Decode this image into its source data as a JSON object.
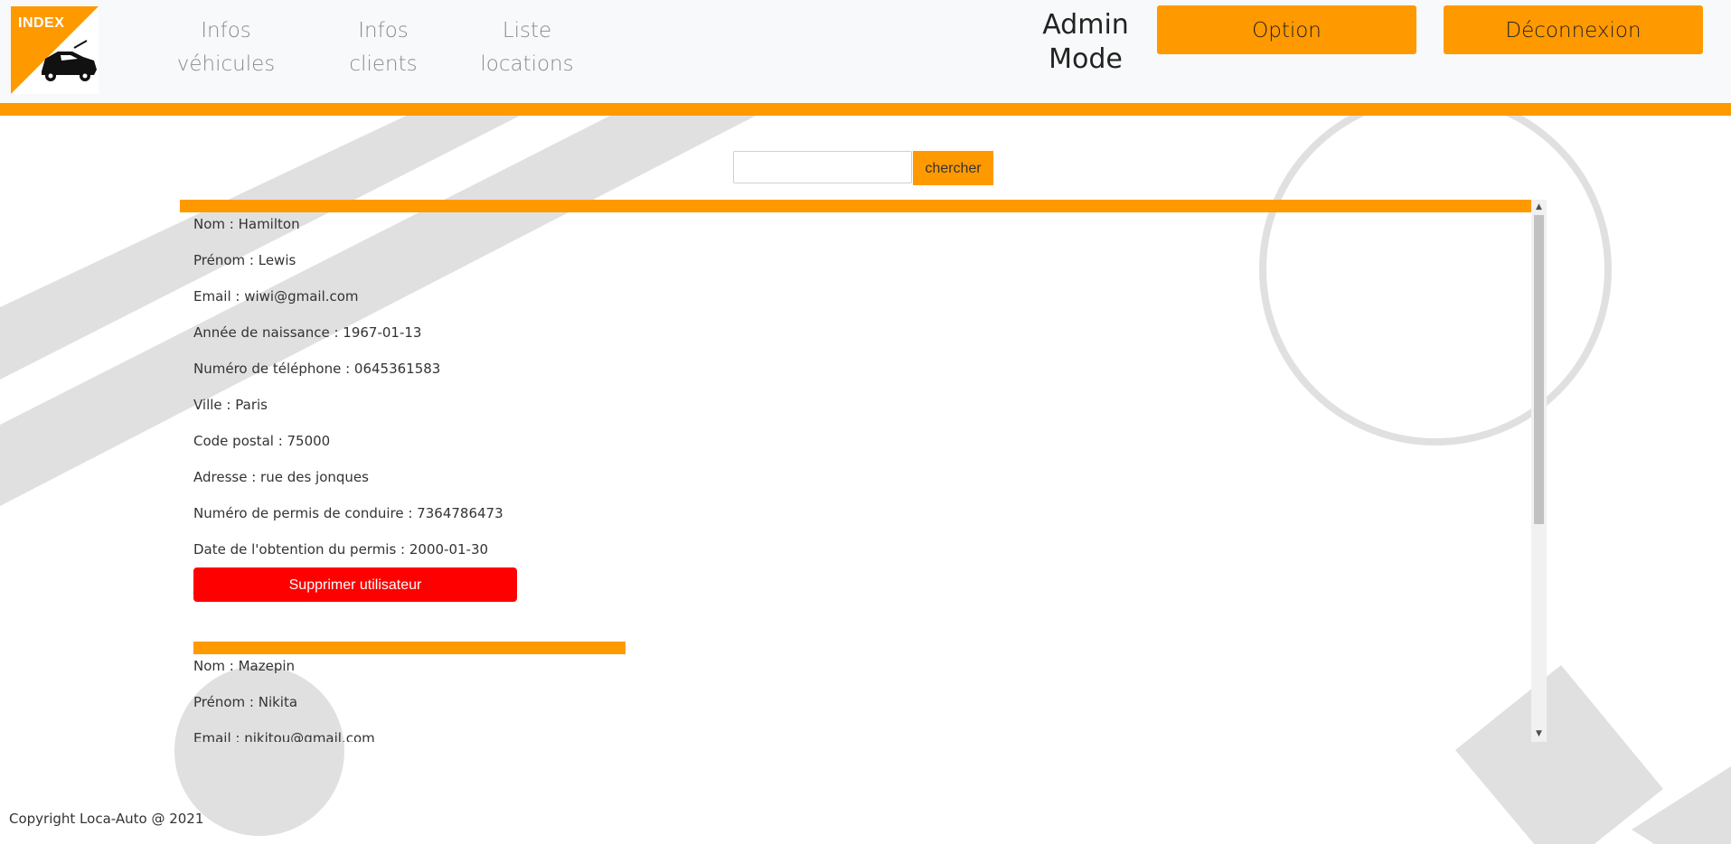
{
  "logo": {
    "label": "INDEX",
    "icon": "car-icon",
    "accent": "#ff9900"
  },
  "nav": [
    {
      "line1": "Infos",
      "line2": "véhicules"
    },
    {
      "line1": "Infos",
      "line2": "clients"
    },
    {
      "line1": "Liste",
      "line2": "locations"
    }
  ],
  "header": {
    "admin_line1": "Admin",
    "admin_line2": "Mode",
    "option_label": "Option",
    "logout_label": "Déconnexion"
  },
  "search": {
    "value": "",
    "button_label": "chercher"
  },
  "records": [
    {
      "fields": [
        "Nom : Hamilton",
        "Prénom : Lewis",
        "Email : wiwi@gmail.com",
        "Année de naissance : 1967-01-13",
        "Numéro de téléphone : 0645361583",
        "Ville : Paris",
        "Code postal : 75000",
        "Adresse : rue des jonques",
        "Numéro de permis de conduire : 7364786473",
        "Date de l'obtention du permis : 2000-01-30"
      ],
      "delete_label": "Supprimer utilisateur"
    },
    {
      "fields": [
        "Nom : Mazepin",
        "Prénom : Nikita",
        "Email : nikitou@gmail.com"
      ]
    }
  ],
  "footer": {
    "copyright": "Copyright Loca-Auto @ 2021"
  },
  "colors": {
    "accent": "#ff9900",
    "danger": "#ff0000",
    "header_bg": "#f8f9fa",
    "decor": "#e0e0e0"
  }
}
